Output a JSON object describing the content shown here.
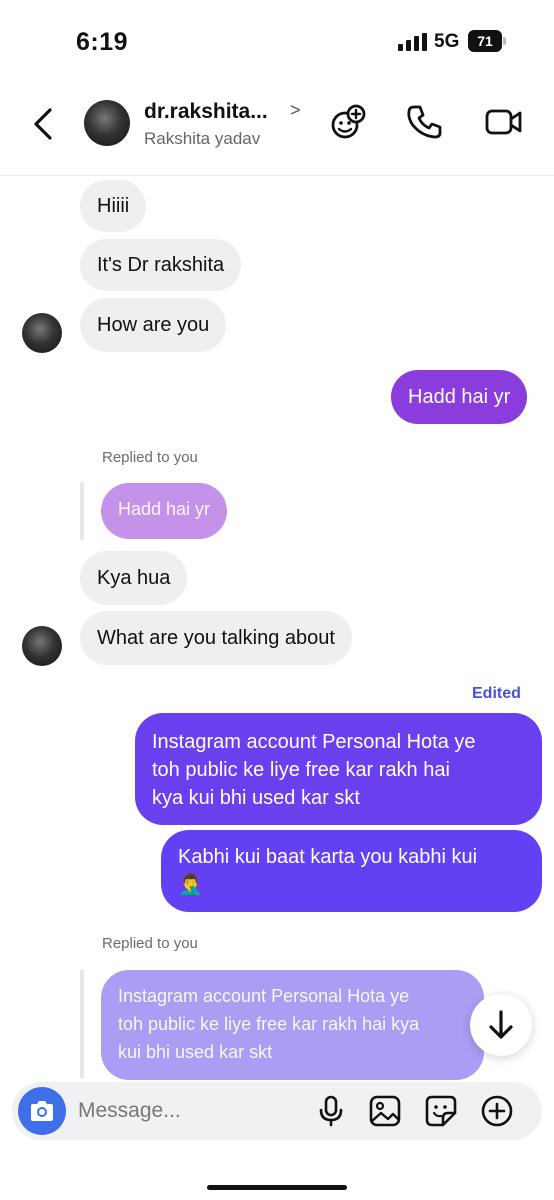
{
  "status_bar": {
    "time": "6:19",
    "network": "5G",
    "battery": "71"
  },
  "header": {
    "username": "dr.rakshita...",
    "display_name": "Rakshita yadav",
    "chevron": ">"
  },
  "messages": [
    {
      "text": "Hiiii",
      "dir": "received"
    },
    {
      "text": "It's Dr rakshita",
      "dir": "received"
    },
    {
      "text": "How are you",
      "dir": "received"
    },
    {
      "text": "Hadd hai yr",
      "dir": "sent"
    },
    {
      "text": "Kya hua",
      "dir": "received"
    },
    {
      "text": "What are you talking about",
      "dir": "received"
    },
    {
      "lines": [
        "Instagram account Personal Hota ye",
        "toh public ke liye free kar rakh hai",
        "kya kui bhi used kar skt"
      ],
      "dir": "sent"
    },
    {
      "lines": [
        "Kabhi kui baat karta you kabhi kui",
        "🤦‍♂️"
      ],
      "dir": "sent"
    }
  ],
  "reply_1": {
    "label": "Replied to you",
    "quoted": "Hadd hai yr"
  },
  "reply_2": {
    "label": "Replied to you",
    "quoted_lines": [
      "Instagram account Personal Hota ye",
      "toh public ke liye free kar rakh hai kya",
      "kui bhi used kar skt"
    ]
  },
  "edited_label": "Edited",
  "composer": {
    "placeholder": "Message..."
  },
  "colors": {
    "accent": "#3f6fe8",
    "sent_1": "#8a3ddc",
    "sent_2": "#6a40ee",
    "sent_3": "#6440f4",
    "reply_1": "#c592ea",
    "reply_2": "#a99ef3",
    "edited": "#4852d6",
    "received": "#efeff1"
  },
  "icons": [
    "back-chevron-icon",
    "add-effect-icon",
    "phone-icon",
    "video-camera-icon",
    "arrow-down-icon",
    "camera-icon",
    "microphone-icon",
    "image-icon",
    "sticker-icon",
    "plus-circle-icon"
  ]
}
